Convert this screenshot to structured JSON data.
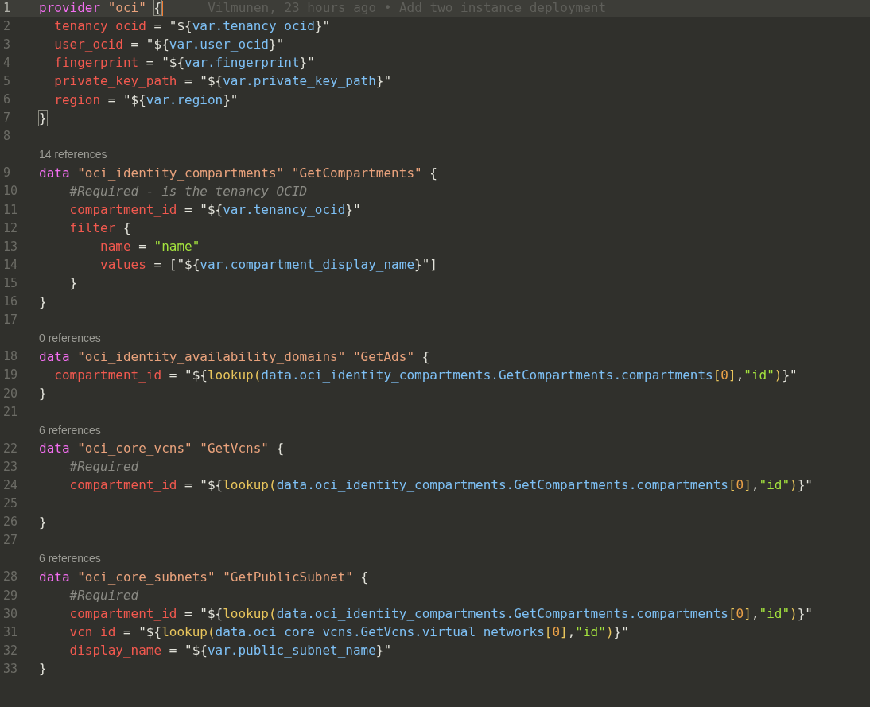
{
  "editor": {
    "lines": [
      {
        "number": "1",
        "current": true,
        "blame": "Vilmunen, 23 hours ago • Add two instance deployment",
        "tokens": [
          {
            "kind": "k",
            "text": "provider"
          },
          {
            "kind": "s",
            "text": " \"oci\""
          },
          {
            "kind": "b",
            "text": " {"
          }
        ]
      },
      {
        "number": "2",
        "current": false,
        "tokens": [
          {
            "kind": "p",
            "text": "  tenancy_ocid"
          },
          {
            "kind": "t",
            "text": " = \"${"
          },
          {
            "kind": "v",
            "text": "var.tenancy_ocid"
          },
          {
            "kind": "t",
            "text": "}\""
          }
        ]
      },
      {
        "number": "3",
        "current": false,
        "tokens": [
          {
            "kind": "p",
            "text": "  user_ocid"
          },
          {
            "kind": "t",
            "text": " = \"${"
          },
          {
            "kind": "v",
            "text": "var.user_ocid"
          },
          {
            "kind": "t",
            "text": "}\""
          }
        ]
      },
      {
        "number": "4",
        "current": false,
        "tokens": [
          {
            "kind": "p",
            "text": "  fingerprint"
          },
          {
            "kind": "t",
            "text": " = \"${"
          },
          {
            "kind": "v",
            "text": "var.fingerprint"
          },
          {
            "kind": "t",
            "text": "}\""
          }
        ]
      },
      {
        "number": "5",
        "current": false,
        "tokens": [
          {
            "kind": "p",
            "text": "  private_key_path"
          },
          {
            "kind": "t",
            "text": " = \"${"
          },
          {
            "kind": "v",
            "text": "var.private_key_path"
          },
          {
            "kind": "t",
            "text": "}\""
          }
        ]
      },
      {
        "number": "6",
        "current": false,
        "tokens": [
          {
            "kind": "p",
            "text": "  region"
          },
          {
            "kind": "t",
            "text": " = \"${"
          },
          {
            "kind": "v",
            "text": "var.region"
          },
          {
            "kind": "t",
            "text": "}\""
          }
        ]
      },
      {
        "number": "7",
        "current": false,
        "tokens": [
          {
            "kind": "b",
            "text": "}"
          }
        ]
      },
      {
        "number": "8",
        "current": false
      },
      {
        "number": "9",
        "current": false,
        "lens": "14 references",
        "tokens": [
          {
            "kind": "k",
            "text": "data"
          },
          {
            "kind": "s",
            "text": " \"oci_identity_compartments\""
          },
          {
            "kind": "s",
            "text": " \"GetCompartments\""
          },
          {
            "kind": "t",
            "text": " {"
          }
        ]
      },
      {
        "number": "10",
        "current": false,
        "tokens": [
          {
            "kind": "c",
            "text": "    #Required - is the tenancy OCID"
          }
        ]
      },
      {
        "number": "11",
        "current": false,
        "tokens": [
          {
            "kind": "p",
            "text": "    compartment_id"
          },
          {
            "kind": "t",
            "text": " = \"${"
          },
          {
            "kind": "v",
            "text": "var.tenancy_ocid"
          },
          {
            "kind": "t",
            "text": "}\""
          }
        ]
      },
      {
        "number": "12",
        "current": false,
        "tokens": [
          {
            "kind": "p",
            "text": "    filter"
          },
          {
            "kind": "t",
            "text": " {"
          }
        ]
      },
      {
        "number": "13",
        "current": false,
        "tokens": [
          {
            "kind": "p",
            "text": "        name"
          },
          {
            "kind": "t",
            "text": " = "
          },
          {
            "kind": "g",
            "text": "\"name\""
          }
        ]
      },
      {
        "number": "14",
        "current": false,
        "tokens": [
          {
            "kind": "p",
            "text": "        values"
          },
          {
            "kind": "t",
            "text": " = [\"${"
          },
          {
            "kind": "v",
            "text": "var.compartment_display_name"
          },
          {
            "kind": "t",
            "text": "}\"]"
          }
        ]
      },
      {
        "number": "15",
        "current": false,
        "tokens": [
          {
            "kind": "t",
            "text": "    }"
          }
        ]
      },
      {
        "number": "16",
        "current": false,
        "tokens": [
          {
            "kind": "t",
            "text": "}"
          }
        ]
      },
      {
        "number": "17",
        "current": false
      },
      {
        "number": "18",
        "current": false,
        "lens": "0 references",
        "tokens": [
          {
            "kind": "k",
            "text": "data"
          },
          {
            "kind": "s",
            "text": " \"oci_identity_availability_domains\""
          },
          {
            "kind": "s",
            "text": " \"GetAds\""
          },
          {
            "kind": "t",
            "text": " {"
          }
        ]
      },
      {
        "number": "19",
        "current": false,
        "tokens": [
          {
            "kind": "p",
            "text": "  compartment_id"
          },
          {
            "kind": "t",
            "text": " = \"${"
          },
          {
            "kind": "f",
            "text": "lookup("
          },
          {
            "kind": "v",
            "text": "data.oci_identity_compartments.GetCompartments.compartments"
          },
          {
            "kind": "f",
            "text": "["
          },
          {
            "kind": "n",
            "text": "0"
          },
          {
            "kind": "f",
            "text": "]"
          },
          {
            "kind": "t",
            "text": ","
          },
          {
            "kind": "g",
            "text": "\"id\""
          },
          {
            "kind": "f",
            "text": ")"
          },
          {
            "kind": "t",
            "text": "}\""
          }
        ]
      },
      {
        "number": "20",
        "current": false,
        "tokens": [
          {
            "kind": "t",
            "text": "}"
          }
        ]
      },
      {
        "number": "21",
        "current": false
      },
      {
        "number": "22",
        "current": false,
        "lens": "6 references",
        "tokens": [
          {
            "kind": "k",
            "text": "data"
          },
          {
            "kind": "s",
            "text": " \"oci_core_vcns\""
          },
          {
            "kind": "s",
            "text": " \"GetVcns\""
          },
          {
            "kind": "t",
            "text": " {"
          }
        ]
      },
      {
        "number": "23",
        "current": false,
        "tokens": [
          {
            "kind": "c",
            "text": "    #Required"
          }
        ]
      },
      {
        "number": "24",
        "current": false,
        "tokens": [
          {
            "kind": "p",
            "text": "    compartment_id"
          },
          {
            "kind": "t",
            "text": " = \"${"
          },
          {
            "kind": "f",
            "text": "lookup("
          },
          {
            "kind": "v",
            "text": "data.oci_identity_compartments.GetCompartments.compartments"
          },
          {
            "kind": "f",
            "text": "["
          },
          {
            "kind": "n",
            "text": "0"
          },
          {
            "kind": "f",
            "text": "]"
          },
          {
            "kind": "t",
            "text": ","
          },
          {
            "kind": "g",
            "text": "\"id\""
          },
          {
            "kind": "f",
            "text": ")"
          },
          {
            "kind": "t",
            "text": "}\""
          }
        ]
      },
      {
        "number": "25",
        "current": false
      },
      {
        "number": "26",
        "current": false,
        "tokens": [
          {
            "kind": "t",
            "text": "}"
          }
        ]
      },
      {
        "number": "27",
        "current": false
      },
      {
        "number": "28",
        "current": false,
        "lens": "6 references",
        "tokens": [
          {
            "kind": "k",
            "text": "data"
          },
          {
            "kind": "s",
            "text": " \"oci_core_subnets\""
          },
          {
            "kind": "s",
            "text": " \"GetPublicSubnet\""
          },
          {
            "kind": "t",
            "text": " {"
          }
        ]
      },
      {
        "number": "29",
        "current": false,
        "tokens": [
          {
            "kind": "c",
            "text": "    #Required"
          }
        ]
      },
      {
        "number": "30",
        "current": false,
        "tokens": [
          {
            "kind": "p",
            "text": "    compartment_id"
          },
          {
            "kind": "t",
            "text": " = \"${"
          },
          {
            "kind": "f",
            "text": "lookup("
          },
          {
            "kind": "v",
            "text": "data.oci_identity_compartments.GetCompartments.compartments"
          },
          {
            "kind": "f",
            "text": "["
          },
          {
            "kind": "n",
            "text": "0"
          },
          {
            "kind": "f",
            "text": "]"
          },
          {
            "kind": "t",
            "text": ","
          },
          {
            "kind": "g",
            "text": "\"id\""
          },
          {
            "kind": "f",
            "text": ")"
          },
          {
            "kind": "t",
            "text": "}\""
          }
        ]
      },
      {
        "number": "31",
        "current": false,
        "tokens": [
          {
            "kind": "p",
            "text": "    vcn_id"
          },
          {
            "kind": "t",
            "text": " = \"${"
          },
          {
            "kind": "f",
            "text": "lookup("
          },
          {
            "kind": "v",
            "text": "data.oci_core_vcns.GetVcns.virtual_networks"
          },
          {
            "kind": "f",
            "text": "["
          },
          {
            "kind": "n",
            "text": "0"
          },
          {
            "kind": "f",
            "text": "]"
          },
          {
            "kind": "t",
            "text": ","
          },
          {
            "kind": "g",
            "text": "\"id\""
          },
          {
            "kind": "f",
            "text": ")"
          },
          {
            "kind": "t",
            "text": "}\""
          }
        ]
      },
      {
        "number": "32",
        "current": false,
        "tokens": [
          {
            "kind": "p",
            "text": "    display_name"
          },
          {
            "kind": "t",
            "text": " = \"${"
          },
          {
            "kind": "v",
            "text": "var.public_subnet_name"
          },
          {
            "kind": "t",
            "text": "}\""
          }
        ]
      },
      {
        "number": "33",
        "current": false,
        "tokens": [
          {
            "kind": "t",
            "text": "}"
          }
        ]
      }
    ]
  }
}
